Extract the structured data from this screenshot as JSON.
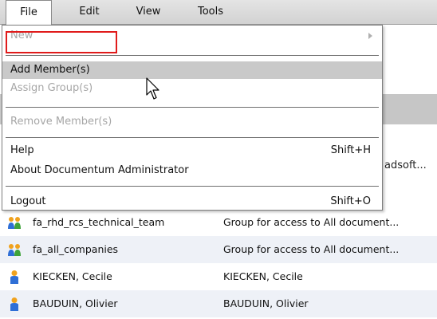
{
  "menubar": {
    "items": [
      {
        "label": "File",
        "active": true
      },
      {
        "label": "Edit",
        "active": false
      },
      {
        "label": "View",
        "active": false
      },
      {
        "label": "Tools",
        "active": false
      }
    ]
  },
  "file_menu": {
    "new": {
      "label": "New",
      "disabled": true,
      "has_submenu": true
    },
    "add_members": {
      "label": "Add Member(s)",
      "highlighted": true
    },
    "assign_groups": {
      "label": "Assign Group(s)",
      "disabled": true
    },
    "remove_members": {
      "label": "Remove Member(s)",
      "disabled": true
    },
    "help": {
      "label": "Help",
      "shortcut": "Shift+H"
    },
    "about": {
      "label": "About Documentum Administrator"
    },
    "logout": {
      "label": "Logout",
      "shortcut": "Shift+O"
    }
  },
  "background": {
    "partial_text": "adsoft..."
  },
  "members_list": {
    "rows": [
      {
        "icon": "group-icon",
        "name": "fa_rhd_rcs_technical_team",
        "description": "Group for access to All document..."
      },
      {
        "icon": "group-icon",
        "name": "fa_all_companies",
        "description": "Group for access to All document..."
      },
      {
        "icon": "user-icon",
        "name": "KIECKEN, Cecile",
        "description": "KIECKEN, Cecile"
      },
      {
        "icon": "user-icon",
        "name": "BAUDUIN, Olivier",
        "description": "BAUDUIN, Olivier"
      }
    ]
  },
  "colors": {
    "highlight_box": "#e01b1b",
    "hover_background": "#c9c9c9",
    "disabled_text": "#a6a6a6",
    "row_alt_background": "#eef1f7"
  }
}
